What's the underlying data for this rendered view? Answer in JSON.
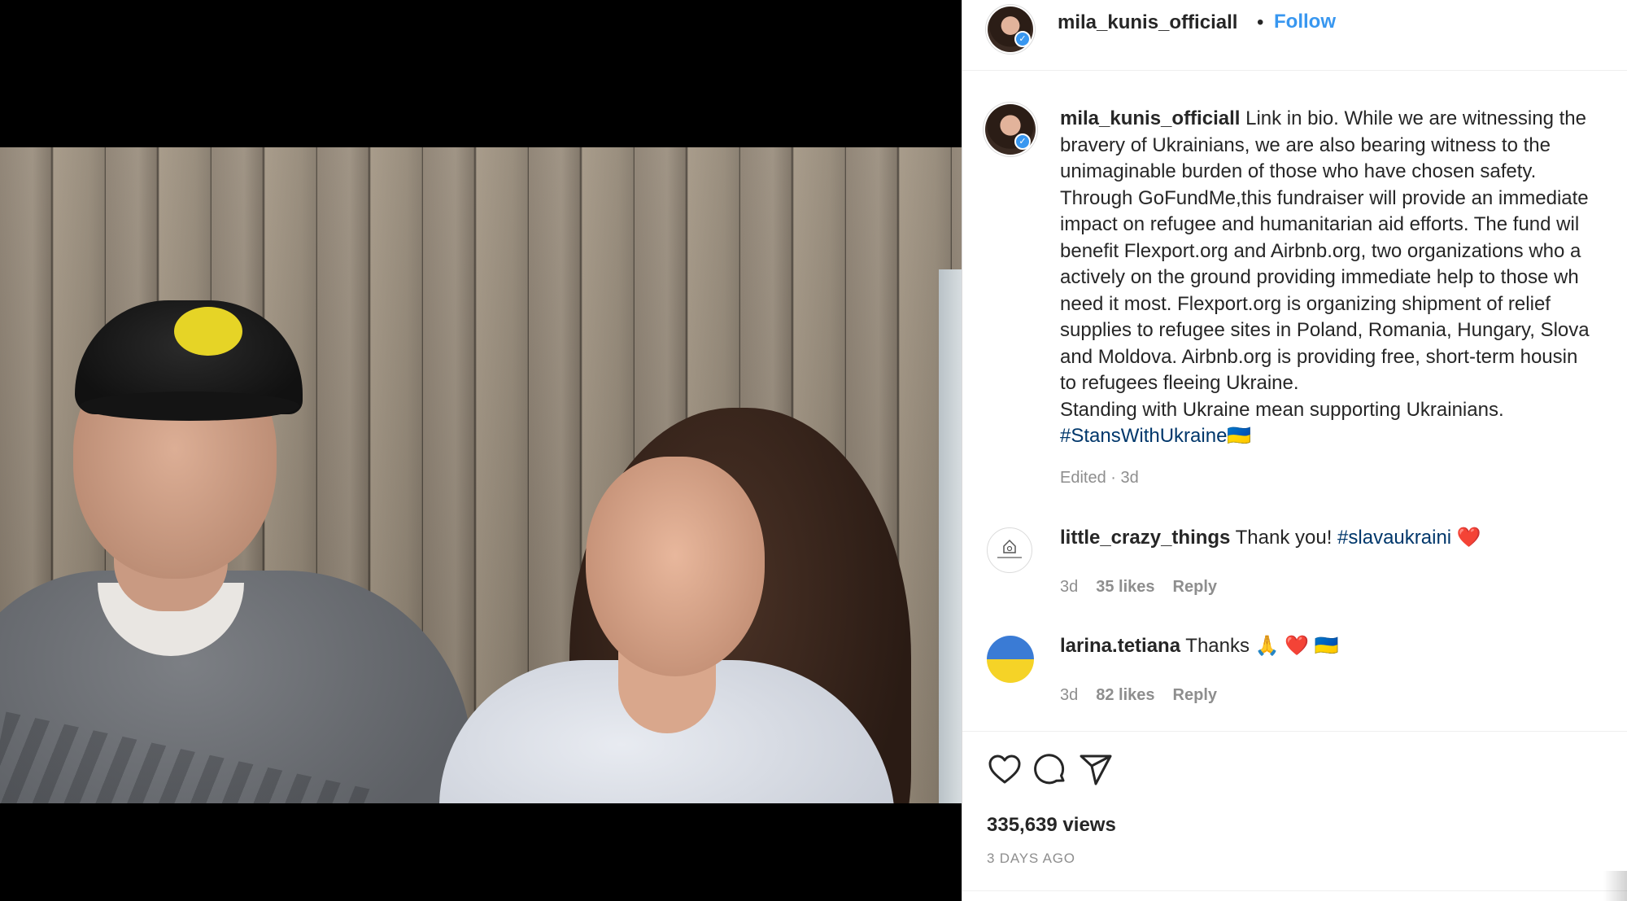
{
  "video": {
    "description_alt": ""
  },
  "header": {
    "username": "mila_kunis_officiall",
    "separator": "•",
    "follow_label": "Follow"
  },
  "caption": {
    "username": "mila_kunis_officiall",
    "text": " Link in bio. While we are witnessing the\nbravery of Ukrainians, we are also bearing witness to the\nunimaginable burden of those who have chosen safety.\nThrough GoFundMe,this fundraiser will provide an immediate\nimpact on refugee and humanitarian aid efforts. The fund wil\nbenefit Flexport.org and Airbnb.org, two organizations who a\nactively on the ground providing immediate help to those wh\nneed it most. Flexport.org is organizing shipment of relief\nsupplies to refugee sites in Poland, Romania, Hungary, Slova\nand Moldova. Airbnb.org is providing free, short-term housin\nto refugees fleeing Ukraine.\nStanding with Ukraine mean supporting Ukrainians.\n",
    "hashtag": "#StansWithUkraine",
    "flag_emoji": "🇺🇦",
    "meta": "Edited · 3d"
  },
  "comments": [
    {
      "username": "little_crazy_things",
      "text": " Thank you! ",
      "hashtag": "#slavaukraini",
      "emoji": " ❤️",
      "age": "3d",
      "likes": "35 likes",
      "reply": "Reply",
      "avatar_text": "LITTLE CRAZY THINGS"
    },
    {
      "username": "larina.tetiana",
      "text": " Thanks 🙏 ❤️ 🇺🇦",
      "age": "3d",
      "likes": "82 likes",
      "reply": "Reply"
    }
  ],
  "actions": {
    "like_icon": "heart-icon",
    "comment_icon": "comment-icon",
    "share_icon": "paper-plane-icon"
  },
  "stats": {
    "views": "335,639 views",
    "time_ago": "3 DAYS AGO"
  },
  "colors": {
    "link_blue": "#3897f0",
    "hashtag_blue": "#00376b",
    "muted_gray": "#8e8e8e",
    "text": "#262626"
  }
}
